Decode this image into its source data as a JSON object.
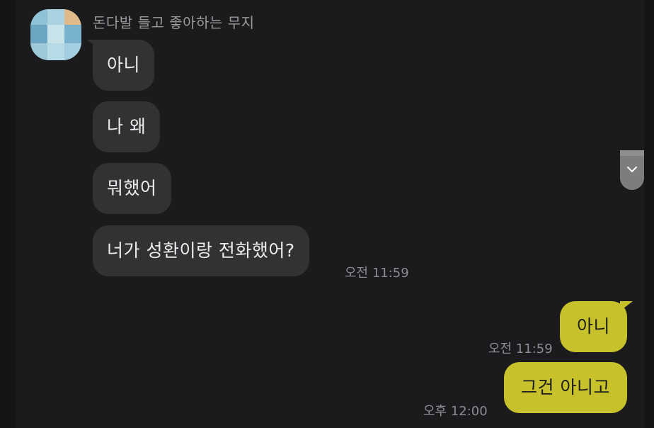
{
  "chat": {
    "sender_name": "돈다발 들고 좋아하는 무지",
    "incoming": [
      {
        "text": "아니"
      },
      {
        "text": "나 왜"
      },
      {
        "text": "뭐했어"
      },
      {
        "text": "너가 성환이랑 전화했어?",
        "time": "오전 11:59"
      }
    ],
    "outgoing": [
      {
        "text": "아니",
        "time": "오전 11:59"
      },
      {
        "text": "그건 아니고",
        "time": "오후 12:00"
      }
    ]
  },
  "colors": {
    "background": "#1b1b1d",
    "incoming_bubble": "#323235",
    "outgoing_bubble": "#c7c12c",
    "timestamp": "#8c8c90"
  },
  "icons": {
    "scroll_down": "chevron-down-icon"
  }
}
